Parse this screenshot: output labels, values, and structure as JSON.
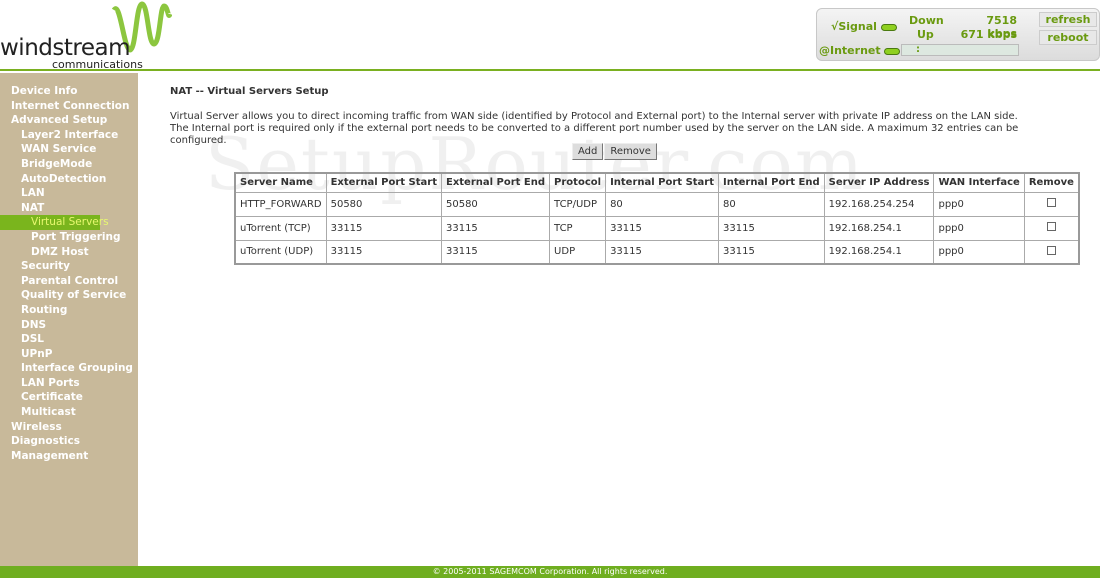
{
  "header": {
    "logo_text": "windstream",
    "logo_sub": "communications",
    "signal_label": "√Signal",
    "internet_label": "@Internet",
    "down_label": "Down",
    "up_label": "Up",
    "down_value": "7518 kbps",
    "up_value": "671 kbps",
    "ip_value": ":",
    "refresh_label": "refresh",
    "reboot_label": "reboot"
  },
  "sidebar": {
    "items": [
      {
        "label": "Device Info",
        "level": 0
      },
      {
        "label": "Internet Connection",
        "level": 0
      },
      {
        "label": "Advanced Setup",
        "level": 0
      },
      {
        "label": "Layer2 Interface",
        "level": 1
      },
      {
        "label": "WAN Service",
        "level": 1
      },
      {
        "label": "BridgeMode",
        "level": 1
      },
      {
        "label": "AutoDetection",
        "level": 1
      },
      {
        "label": "LAN",
        "level": 1
      },
      {
        "label": "NAT",
        "level": 1
      },
      {
        "label": "Virtual Servers",
        "level": 2,
        "active": true
      },
      {
        "label": "Port Triggering",
        "level": 2
      },
      {
        "label": "DMZ Host",
        "level": 2
      },
      {
        "label": "Security",
        "level": 1
      },
      {
        "label": "Parental Control",
        "level": 1
      },
      {
        "label": "Quality of Service",
        "level": 1
      },
      {
        "label": "Routing",
        "level": 1
      },
      {
        "label": "DNS",
        "level": 1
      },
      {
        "label": "DSL",
        "level": 1
      },
      {
        "label": "UPnP",
        "level": 1
      },
      {
        "label": "Interface Grouping",
        "level": 1
      },
      {
        "label": "LAN Ports",
        "level": 1
      },
      {
        "label": "Certificate",
        "level": 1
      },
      {
        "label": "Multicast",
        "level": 1
      },
      {
        "label": "Wireless",
        "level": 0
      },
      {
        "label": "Diagnostics",
        "level": 0
      },
      {
        "label": "Management",
        "level": 0
      }
    ]
  },
  "main": {
    "title": "NAT -- Virtual Servers Setup",
    "description": "Virtual Server allows you to direct incoming traffic from WAN side (identified by Protocol and External port) to the Internal server with private IP address on the LAN side. The Internal port is required only if the external port needs to be converted to a different port number used by the server on the LAN side. A maximum 32 entries can be configured.",
    "add_label": "Add",
    "remove_label": "Remove",
    "table": {
      "headers": [
        "Server Name",
        "External Port Start",
        "External Port End",
        "Protocol",
        "Internal Port Start",
        "Internal Port End",
        "Server IP Address",
        "WAN Interface",
        "Remove"
      ],
      "rows": [
        [
          "HTTP_FORWARD",
          "50580",
          "50580",
          "TCP/UDP",
          "80",
          "80",
          "192.168.254.254",
          "ppp0"
        ],
        [
          "uTorrent (TCP)",
          "33115",
          "33115",
          "TCP",
          "33115",
          "33115",
          "192.168.254.1",
          "ppp0"
        ],
        [
          "uTorrent (UDP)",
          "33115",
          "33115",
          "UDP",
          "33115",
          "33115",
          "192.168.254.1",
          "ppp0"
        ]
      ]
    }
  },
  "watermark": "SetupRouter.com",
  "footer": "© 2005-2011 SAGEMCOM Corporation. All rights reserved.",
  "colors": {
    "accent": "#7ab51d",
    "sidebar": "#c8b99a",
    "footer": "#6fae20"
  }
}
